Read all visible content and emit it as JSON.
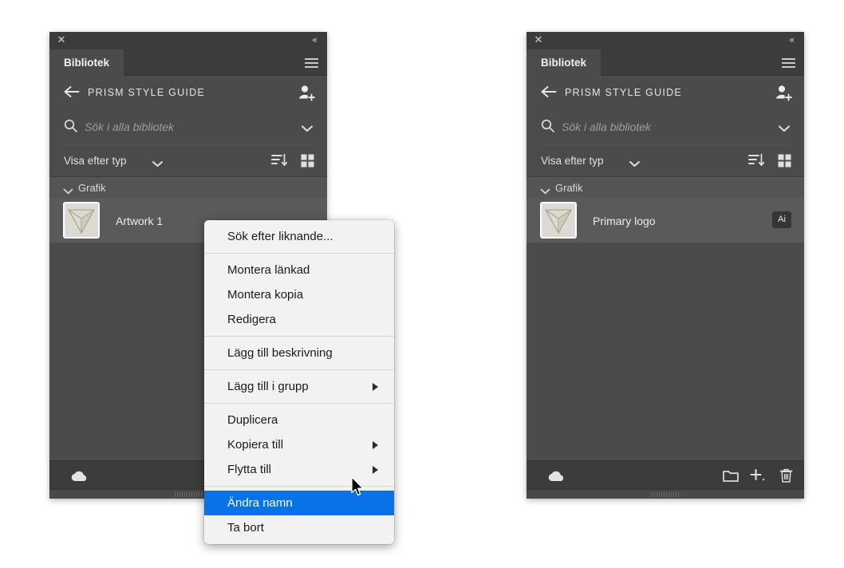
{
  "app": {
    "accent_selection": "#0a72e8",
    "panel_bg": "#4b4b4b",
    "chrome_bg": "#3c3c3c",
    "menu_bg": "#f2f2f2"
  },
  "panels": [
    {
      "id": "left",
      "titlebar": {
        "close": "✕",
        "collapse": "«"
      },
      "tab": {
        "label": "Bibliotek",
        "menu_icon": "hamburger-icon"
      },
      "library_header": {
        "back_icon": "back-arrow-icon",
        "title": "PRISM STYLE GUIDE",
        "invite_icon": "invite-collaborator-icon"
      },
      "search": {
        "icon": "search-icon",
        "placeholder": "Sök i alla bibliotek",
        "value": "",
        "caret_icon": "chevron-down-icon"
      },
      "filter": {
        "label": "Visa efter typ",
        "caret_icon": "chevron-down-icon",
        "sort_icon": "sort-descending-icon",
        "grid_icon": "grid-view-icon"
      },
      "group": {
        "caret_icon": "chevron-down-icon",
        "label": "Grafik"
      },
      "asset": {
        "thumbnail_icon": "prism-logo-thumbnail",
        "name": "Artwork 1",
        "badge": ""
      },
      "footer": {
        "cloud_icon": "cloud-sync-icon",
        "folder_icon": "new-library-icon",
        "plus_icon": "add-element-icon",
        "trash_icon": "delete-icon"
      }
    },
    {
      "id": "right",
      "titlebar": {
        "close": "✕",
        "collapse": "«"
      },
      "tab": {
        "label": "Bibliotek",
        "menu_icon": "hamburger-icon"
      },
      "library_header": {
        "back_icon": "back-arrow-icon",
        "title": "PRISM STYLE GUIDE",
        "invite_icon": "invite-collaborator-icon"
      },
      "search": {
        "icon": "search-icon",
        "placeholder": "Sök i alla bibliotek",
        "value": "",
        "caret_icon": "chevron-down-icon"
      },
      "filter": {
        "label": "Visa efter typ",
        "caret_icon": "chevron-down-icon",
        "sort_icon": "sort-descending-icon",
        "grid_icon": "grid-view-icon"
      },
      "group": {
        "caret_icon": "chevron-down-icon",
        "label": "Grafik"
      },
      "asset": {
        "thumbnail_icon": "prism-logo-thumbnail",
        "name": "Primary logo",
        "badge": "Ai"
      },
      "footer": {
        "cloud_icon": "cloud-sync-icon",
        "folder_icon": "new-library-icon",
        "plus_icon": "add-element-icon",
        "trash_icon": "delete-icon"
      }
    }
  ],
  "context_menu": {
    "items": [
      {
        "label": "Sök efter liknande...",
        "submenu": false,
        "selected": false
      },
      {
        "separator": true
      },
      {
        "label": "Montera länkad",
        "submenu": false,
        "selected": false
      },
      {
        "label": "Montera kopia",
        "submenu": false,
        "selected": false
      },
      {
        "label": "Redigera",
        "submenu": false,
        "selected": false
      },
      {
        "separator": true
      },
      {
        "label": "Lägg till beskrivning",
        "submenu": false,
        "selected": false
      },
      {
        "separator": true
      },
      {
        "label": "Lägg till i grupp",
        "submenu": true,
        "selected": false
      },
      {
        "separator": true
      },
      {
        "label": "Duplicera",
        "submenu": false,
        "selected": false
      },
      {
        "label": "Kopiera till",
        "submenu": true,
        "selected": false
      },
      {
        "label": "Flytta till",
        "submenu": true,
        "selected": false
      },
      {
        "separator": true
      },
      {
        "label": "Ändra namn",
        "submenu": false,
        "selected": true
      },
      {
        "label": "Ta bort",
        "submenu": false,
        "selected": false
      }
    ]
  },
  "cursor": {
    "icon": "mouse-pointer-icon"
  }
}
